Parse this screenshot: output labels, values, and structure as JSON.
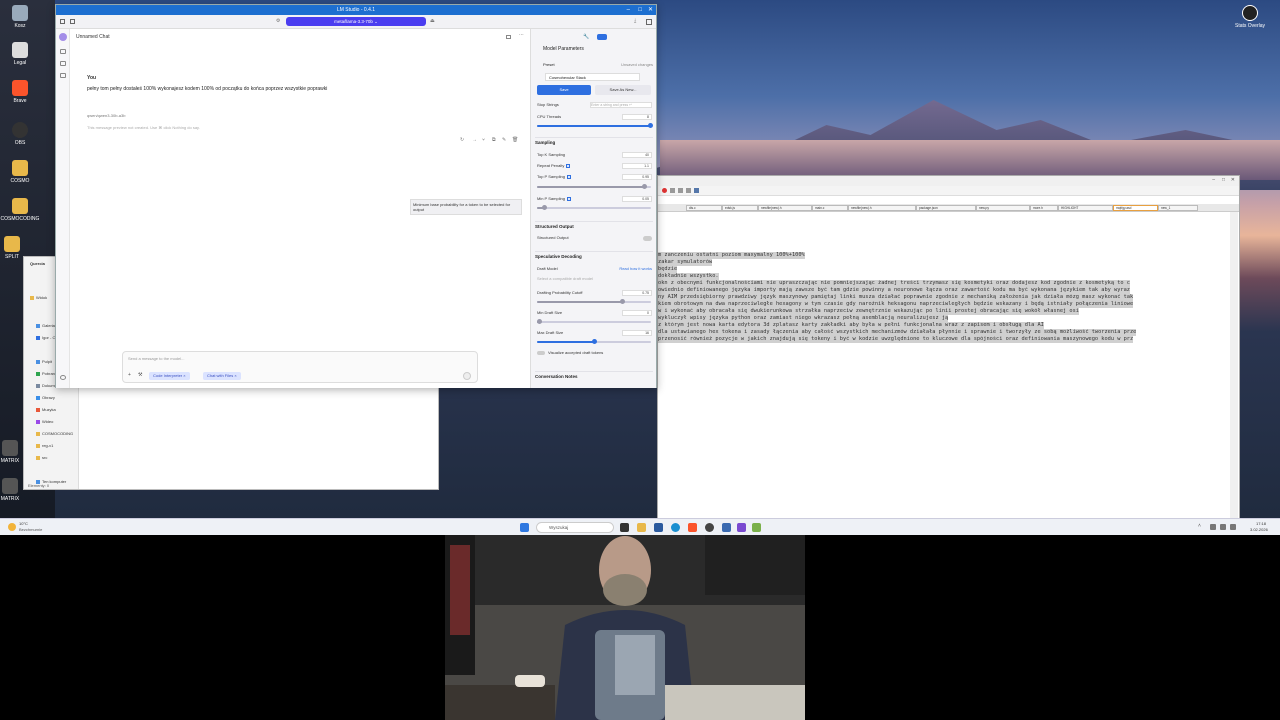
{
  "lm_studio": {
    "window_title": "LM Studio - 0.4.1",
    "model_selector": "meta/llama-3.3-70b",
    "chat_title": "Unnamed Chat",
    "message_sender": "You",
    "message_text": "pełny tom pełny dostałeś 100% wykonajesz kodem 100% od początku do końca poprzez wszystkie poprawki",
    "assistant_model": "qwen/qwen3-30b-a3b",
    "assistant_placeholder": "This message preview not created. Use ⌘ click Nothing do say.",
    "input_placeholder": "Send a message to the model...",
    "chips": [
      "Code Interpreter",
      "Chat with Files"
    ],
    "tooltip": "Minimum base probability for a token to be selected for output"
  },
  "params": {
    "header": "Model Parameters",
    "preset_label": "Preset",
    "preset_status": "Unsaved changes",
    "preset_value": "Cosmohexular Stack",
    "save_label": "Save",
    "save_as_label": "Save As New...",
    "stop_strings_label": "Stop Strings",
    "stop_strings_placeholder": "Enter a string and press ↵",
    "cpu_threads_label": "CPU Threads",
    "cpu_threads_value": "8",
    "sampling_header": "Sampling",
    "top_k_label": "Top K Sampling",
    "top_k_value": "40",
    "repeat_label": "Repeat Penalty",
    "repeat_value": "1.1",
    "top_p_label": "Top P Sampling",
    "top_p_value": "0.95",
    "min_p_label": "Min P Sampling",
    "min_p_value": "0.05",
    "structured_header": "Structured Output",
    "structured_label": "Structured Output",
    "spec_header": "Speculative Decoding",
    "draft_model_label": "Draft Model",
    "draft_model_link": "Read how it works",
    "draft_model_placeholder": "Select a compatible draft model",
    "drafting_label": "Drafting Probability Cutoff",
    "drafting_value": "0.75",
    "min_draft_label": "Min Draft Size",
    "min_draft_value": "0",
    "max_draft_label": "Max Draft Size",
    "max_draft_value": "16",
    "visualize_label": "Visualize accepted draft tokens",
    "notes_label": "Conversation Notes"
  },
  "explorer": {
    "header": "Quercia",
    "items": [
      "Pulpit",
      "Pobrane",
      "Dokumenty",
      "Obrazy",
      "Muzyka",
      "Wideo",
      "COSMOCODING",
      "reg-v1",
      "src"
    ],
    "top_items": [
      "Widok",
      "Galeria",
      "Igor - Osobiste"
    ],
    "this_pc": "Ten komputer",
    "status": "Elementy: 0"
  },
  "editor": {
    "tabs": [
      "dis.c",
      "edsk.js",
      "newfile(new).h",
      "main.c",
      "newfile(new).h",
      "package.json",
      "new.py",
      "more.h",
      "HIGHLIGHT",
      "mqtfgy.asd",
      "new_1"
    ],
    "lines": [
      "m zanczeniu ostatni poziom maxymalny 100%+100%",
      " zakar symulatorów",
      "będzie",
      "dokładnie wszystko.",
      "okn z obecnymi funkcjonalnościami nie upraszczając nie pomniejszając żadnej treści trzymasz się kosmetyki oraz dodajesz kod zgodnie z kosmetyką to c",
      "owiednio definiowanego języka importy mają zawsze być tam gdzie powinny a neuronowe łącza oraz zawartość kodu ma być wykonana językiem tak aby wyraz",
      "ny AIM przedsiębiorny prawdziwy język maszynowy pamiętaj linki musza działać poprawnie zgodnie z mechaniką założenia jak działa mózg masz wykonać tak",
      "kiem obrotowym na dwa naprzeciwległe hexagony w tym czasie gdy narożnik heksagonu naprzeciwległych będzie wskazany i będą istniały połączenia liniowe",
      "w i wykonać aby obracała się dwukierunkowa strzałka naprzeciw zewnętrznie wskazując po linii prostej obracając się wokół własnej osi",
      " wykluczył wpisy języka python oraz zamiast niego wkrazasz pełną asemblacją neuralizujesz ją",
      "z którym jest nowa karta edytora 3d zplatasz karty zakładki aby była w pełni funkcjonalna wraz z zapisem i obsługą dla AI",
      "dla ustawianego hex tokena i zasady łączenia aby całość wszystkich mechanizmów działała płynnie i sprawnie i tworzyły ze sobą możliwość tworzenia prze",
      "przenosić również pozycje w jakich znajdują się tokeny i być w kodzie uwzględnione to kluczowe dla spójności oraz definiowania maszynowego kodu w prz"
    ]
  },
  "desktop": {
    "icons": [
      "Kosz",
      "Legal",
      "Brave",
      "OBS",
      "COSMO",
      "COSMOCODING",
      "SPLIT",
      "MATRIX",
      "MATRIX"
    ],
    "top_right_icon": "Stats Overlay"
  },
  "taskbar": {
    "weather_temp": "10°C",
    "weather_desc": "Bezchmurnie",
    "search_placeholder": "Wyszukaj",
    "time": "17:18",
    "date": "3.02.2026"
  },
  "colors": {
    "accent": "#2e6fe0",
    "model_pill": "#4b3df0",
    "title_bar": "#1d6fd0"
  }
}
